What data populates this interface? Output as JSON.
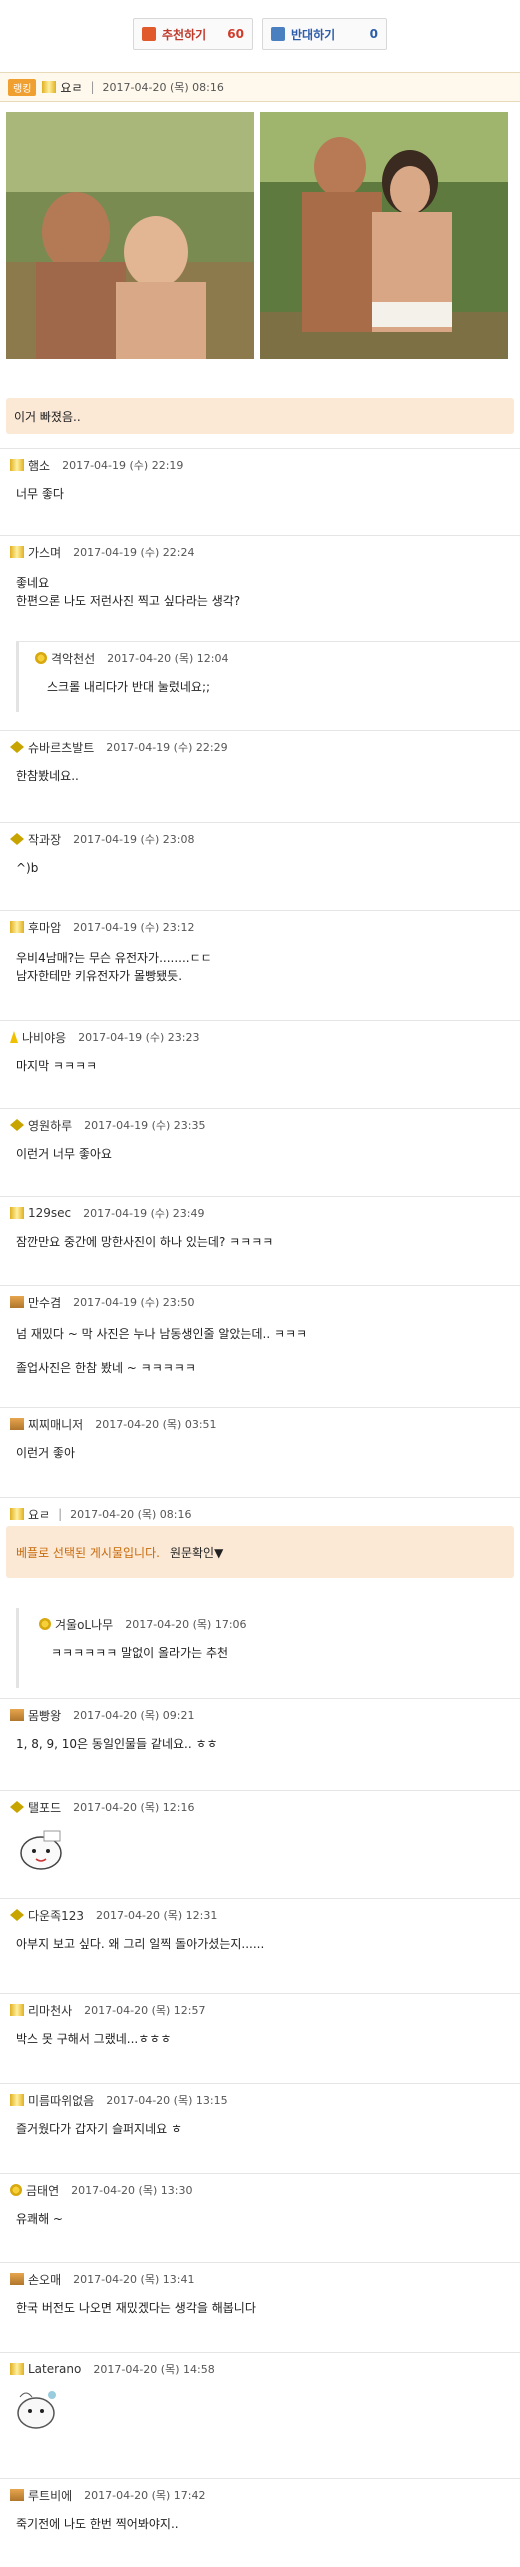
{
  "vote": {
    "up_label": "추천하기",
    "up_count": "60",
    "down_label": "반대하기",
    "down_count": "0"
  },
  "post": {
    "rank": "랭킹",
    "author": "요ㄹ",
    "date": "2017-04-20 (목) 08:16",
    "caption": "이거 빠졌음.."
  },
  "comments": [
    {
      "nick": "햄소",
      "date": "2017-04-19 (수) 22:19",
      "text": [
        "너무 좋다"
      ]
    },
    {
      "nick": "가스며",
      "date": "2017-04-19 (수) 22:24",
      "text": [
        "좋네요",
        "한편으론 나도 저런사진 찍고 싶다라는 생각?"
      ]
    },
    {
      "nick": "격악천선",
      "date": "2017-04-20 (목) 12:04",
      "text": [
        "스크롤 내리다가 반대 눌렀네요;;"
      ]
    },
    {
      "nick": "슈바르츠발트",
      "date": "2017-04-19 (수) 22:29",
      "text": [
        "한참봤네요.."
      ]
    },
    {
      "nick": "작과장",
      "date": "2017-04-19 (수) 23:08",
      "text": [
        "^)b"
      ]
    },
    {
      "nick": "후마암",
      "date": "2017-04-19 (수) 23:12",
      "text": [
        "우비4남매?는 무슨 유전자가........ㄷㄷ",
        "남자한테만 키유전자가 몰빵됐듯."
      ]
    },
    {
      "nick": "나비야응",
      "date": "2017-04-19 (수) 23:23",
      "text": [
        "마지막 ㅋㅋㅋㅋ"
      ]
    },
    {
      "nick": "영원하루",
      "date": "2017-04-19 (수) 23:35",
      "text": [
        "이런거 너무 좋아요"
      ]
    },
    {
      "nick": "129sec",
      "date": "2017-04-19 (수) 23:49",
      "text": [
        "잠깐만요 중간에 망한사진이 하나 있는데? ㅋㅋㅋㅋ"
      ]
    },
    {
      "nick": "만수겸",
      "date": "2017-04-19 (수) 23:50",
      "text": [
        "넘 재밌다 ~   막 사진은 누나 남동생인줄 알았는데.. ㅋㅋㅋ",
        "졸업사진은 한참 봤네 ~ ㅋㅋㅋㅋㅋ"
      ]
    },
    {
      "nick": "찌찌매니저",
      "date": "2017-04-20 (목) 03:51",
      "text": [
        "이런거 좋아"
      ]
    },
    {
      "nick": "요ㄹ",
      "date": "2017-04-20 (목) 08:16",
      "text": [
        "베플로 선택된 게시물입니다."
      ],
      "link": "원문확인▼"
    },
    {
      "nick": "겨울oL나무",
      "date": "2017-04-20 (목) 17:06",
      "text": [
        "ㅋㅋㅋㅋㅋㅋ 말없이 올라가는 추천"
      ]
    },
    {
      "nick": "몸빵왕",
      "date": "2017-04-20 (목) 09:21",
      "text": [
        "1, 8, 9, 10은 동일인물들 같네요.. ㅎㅎ"
      ]
    },
    {
      "nick": "탤포드",
      "date": "2017-04-20 (목) 12:16",
      "text": []
    },
    {
      "nick": "다운족123",
      "date": "2017-04-20 (목) 12:31",
      "text": [
        "아부지 보고 싶다. 왜 그리 일찍 돌아가셨는지......"
      ]
    },
    {
      "nick": "리마천사",
      "date": "2017-04-20 (목) 12:57",
      "text": [
        "박스 못 구해서 그랬네...ㅎㅎㅎ"
      ]
    },
    {
      "nick": "미름따위없음",
      "date": "2017-04-20 (목) 13:15",
      "text": [
        "즐거웠다가 갑자기 슬퍼지네요 ㅎ"
      ]
    },
    {
      "nick": "금태연",
      "date": "2017-04-20 (목) 13:30",
      "text": [
        "유쾌해 ~"
      ]
    },
    {
      "nick": "손오매",
      "date": "2017-04-20 (목) 13:41",
      "text": [
        "한국 버전도 나오면 재밌겠다는 생각을 해봅니다"
      ]
    },
    {
      "nick": "Laterano",
      "date": "2017-04-20 (목) 14:58",
      "text": []
    },
    {
      "nick": "루트비에",
      "date": "2017-04-20 (목) 17:42",
      "text": [
        "죽기전에 나도 한번 찍어봐야지.."
      ]
    }
  ]
}
